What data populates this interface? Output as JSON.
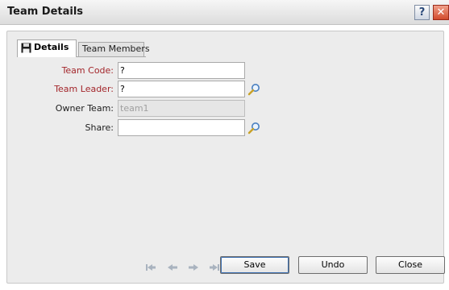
{
  "window": {
    "title": "Team Details",
    "help_glyph": "?",
    "close_glyph": "✕"
  },
  "tabs": [
    {
      "label": "Details",
      "icon": "floppy-disk-icon",
      "active": true
    },
    {
      "label": "Team Members",
      "active": false
    }
  ],
  "form": {
    "team_code": {
      "label": "Team Code:",
      "value": "?",
      "required": true
    },
    "team_leader": {
      "label": "Team Leader:",
      "value": "?",
      "required": true
    },
    "owner_team": {
      "label": "Owner Team:",
      "value": "team1",
      "disabled": true
    },
    "share": {
      "label": "Share:",
      "value": ""
    }
  },
  "colors": {
    "required_label": "#a3262b",
    "panel_bg": "#ececec"
  },
  "buttons": {
    "save": "Save",
    "undo": "Undo",
    "close": "Close"
  },
  "nav_icons": [
    "first-record-icon",
    "previous-record-icon",
    "next-record-icon",
    "last-record-icon"
  ]
}
